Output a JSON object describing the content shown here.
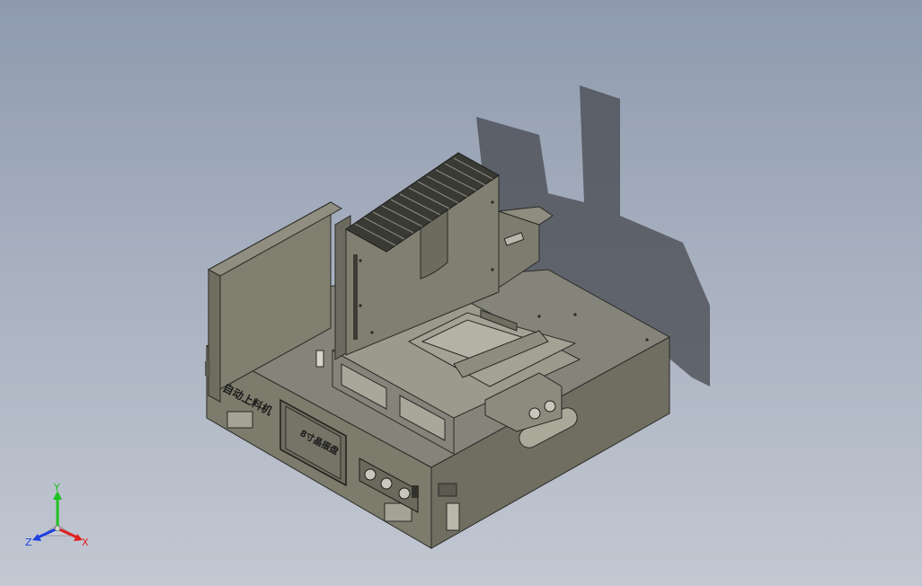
{
  "machine": {
    "side_label": "自动上料机",
    "plate_label": "8寸晶振盘"
  },
  "triad": {
    "x_label": "X",
    "y_label": "Y",
    "z_label": "Z",
    "x_color": "#e02020",
    "y_color": "#20c020",
    "z_color": "#2040e0"
  },
  "colors": {
    "body_face": "#7e7d6e",
    "body_top": "#8c8b7c",
    "body_dark": "#5e5d52",
    "shadow": "#3f4248"
  }
}
